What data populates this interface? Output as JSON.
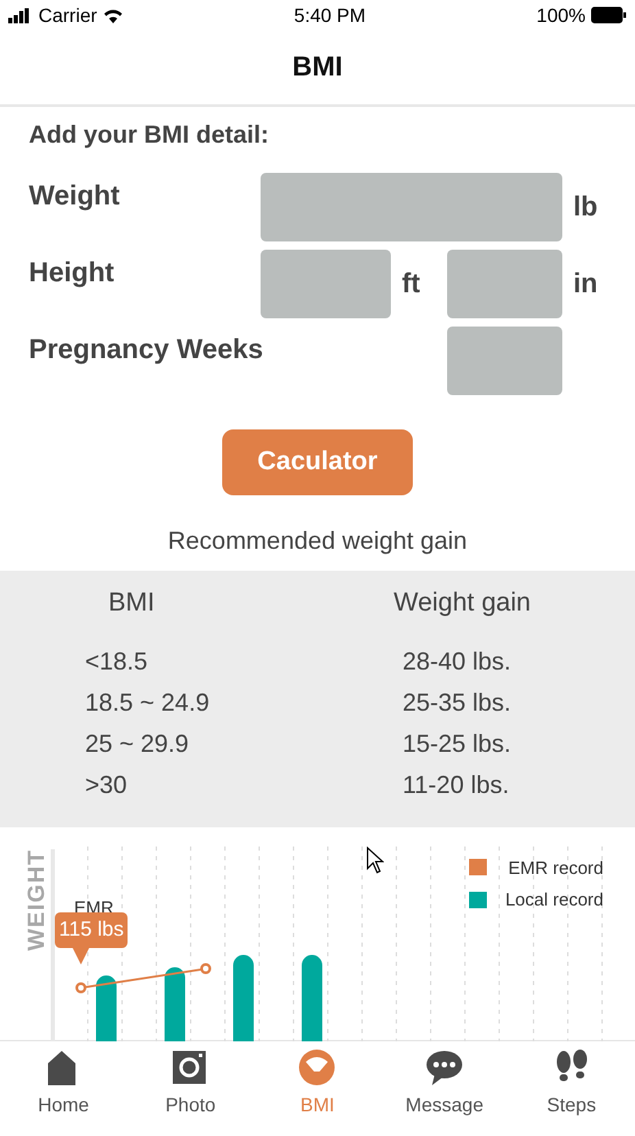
{
  "status_bar": {
    "carrier": "Carrier",
    "time": "5:40 PM",
    "battery": "100%"
  },
  "title": "BMI",
  "form": {
    "heading": "Add your BMI detail:",
    "rows": [
      {
        "label": "Weight",
        "inputs": [
          {
            "kind": "wide",
            "unit": "lb"
          }
        ]
      },
      {
        "label": "Height",
        "inputs": [
          {
            "kind": "short",
            "unit": "ft"
          },
          {
            "kind": "short",
            "unit": "in"
          }
        ]
      },
      {
        "label": "Pregnancy Weeks",
        "inputs": [
          {
            "kind": "end"
          }
        ]
      }
    ],
    "button": "Caculator"
  },
  "recommendation": {
    "title": "Recommended weight gain",
    "columns": [
      "BMI",
      "Weight gain"
    ],
    "rows": [
      [
        "<18.5",
        "28-40 lbs."
      ],
      [
        "18.5 ~ 24.9",
        "25-35 lbs."
      ],
      [
        "25 ~ 29.9",
        "15-25 lbs."
      ],
      [
        ">30",
        "11-20 lbs."
      ]
    ]
  },
  "chart": {
    "axis_label": "WEIGHT",
    "marker_label": "EMR",
    "tooltip": "115 lbs",
    "legend": [
      {
        "label": "EMR record",
        "color": "#e07f47"
      },
      {
        "label": "Local record",
        "color": "#00a99d"
      }
    ]
  },
  "tabs": [
    {
      "label": "Home",
      "selected": false
    },
    {
      "label": "Photo",
      "selected": false
    },
    {
      "label": "BMI",
      "selected": true
    },
    {
      "label": "Message",
      "selected": false
    },
    {
      "label": "Steps",
      "selected": false
    }
  ]
}
